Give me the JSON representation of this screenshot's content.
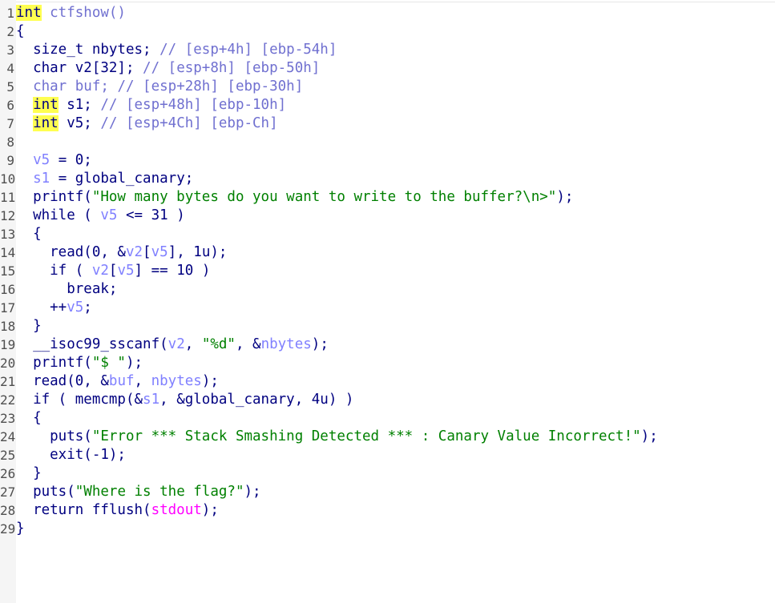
{
  "lines": [
    {
      "n": "1",
      "segs": [
        {
          "t": "int",
          "c": "kw hl"
        },
        {
          "t": " ctfshow()",
          "c": "bl"
        }
      ]
    },
    {
      "n": "2",
      "segs": [
        {
          "t": "{",
          "c": "plain"
        }
      ]
    },
    {
      "n": "3",
      "segs": [
        {
          "t": "  size_t nbytes; ",
          "c": "plain"
        },
        {
          "t": "// [esp+4h] [ebp-54h]",
          "c": "cmt"
        }
      ]
    },
    {
      "n": "4",
      "segs": [
        {
          "t": "  char v2[32]; ",
          "c": "plain"
        },
        {
          "t": "// [esp+8h] [ebp-50h]",
          "c": "cmt"
        }
      ]
    },
    {
      "n": "5",
      "segs": [
        {
          "t": "  char buf; ",
          "c": "bl"
        },
        {
          "t": "// [esp+28h] [ebp-30h]",
          "c": "cmt"
        }
      ]
    },
    {
      "n": "6",
      "segs": [
        {
          "t": "  ",
          "c": "plain"
        },
        {
          "t": "int",
          "c": "kw hl"
        },
        {
          "t": " s1; ",
          "c": "plain"
        },
        {
          "t": "// [esp+48h] [ebp-10h]",
          "c": "cmt"
        }
      ]
    },
    {
      "n": "7",
      "segs": [
        {
          "t": "  ",
          "c": "plain"
        },
        {
          "t": "int",
          "c": "kw hl"
        },
        {
          "t": " v5; ",
          "c": "plain"
        },
        {
          "t": "// [esp+4Ch] [ebp-Ch]",
          "c": "cmt"
        }
      ]
    },
    {
      "n": "8",
      "segs": []
    },
    {
      "n": "9",
      "segs": [
        {
          "t": "  ",
          "c": "plain"
        },
        {
          "t": "v5",
          "c": "var"
        },
        {
          "t": " = 0;",
          "c": "plain"
        }
      ]
    },
    {
      "n": "10",
      "segs": [
        {
          "t": "  ",
          "c": "plain"
        },
        {
          "t": "s1",
          "c": "var"
        },
        {
          "t": " = global_canary;",
          "c": "plain"
        }
      ]
    },
    {
      "n": "11",
      "segs": [
        {
          "t": "  printf(",
          "c": "plain"
        },
        {
          "t": "\"How many bytes do you want to write to the buffer?\\n>\"",
          "c": "str"
        },
        {
          "t": ");",
          "c": "plain"
        }
      ]
    },
    {
      "n": "12",
      "segs": [
        {
          "t": "  while ( ",
          "c": "plain"
        },
        {
          "t": "v5",
          "c": "var"
        },
        {
          "t": " <= 31 )",
          "c": "plain"
        }
      ]
    },
    {
      "n": "13",
      "segs": [
        {
          "t": "  {",
          "c": "plain"
        }
      ]
    },
    {
      "n": "14",
      "segs": [
        {
          "t": "    read(0, &",
          "c": "plain"
        },
        {
          "t": "v2",
          "c": "var"
        },
        {
          "t": "[",
          "c": "plain"
        },
        {
          "t": "v5",
          "c": "var"
        },
        {
          "t": "], 1u);",
          "c": "plain"
        }
      ]
    },
    {
      "n": "15",
      "segs": [
        {
          "t": "    if ( ",
          "c": "plain"
        },
        {
          "t": "v2",
          "c": "var"
        },
        {
          "t": "[",
          "c": "plain"
        },
        {
          "t": "v5",
          "c": "var"
        },
        {
          "t": "] == 10 )",
          "c": "plain"
        }
      ]
    },
    {
      "n": "16",
      "segs": [
        {
          "t": "      break;",
          "c": "plain"
        }
      ]
    },
    {
      "n": "17",
      "segs": [
        {
          "t": "    ++",
          "c": "plain"
        },
        {
          "t": "v5",
          "c": "var"
        },
        {
          "t": ";",
          "c": "plain"
        }
      ]
    },
    {
      "n": "18",
      "segs": [
        {
          "t": "  }",
          "c": "plain"
        }
      ]
    },
    {
      "n": "19",
      "segs": [
        {
          "t": "  __isoc99_sscanf(",
          "c": "plain"
        },
        {
          "t": "v2",
          "c": "var"
        },
        {
          "t": ", ",
          "c": "plain"
        },
        {
          "t": "\"%d\"",
          "c": "str"
        },
        {
          "t": ", &",
          "c": "plain"
        },
        {
          "t": "nbytes",
          "c": "var"
        },
        {
          "t": ");",
          "c": "plain"
        }
      ]
    },
    {
      "n": "20",
      "segs": [
        {
          "t": "  printf(",
          "c": "plain"
        },
        {
          "t": "\"$ \"",
          "c": "str"
        },
        {
          "t": ");",
          "c": "plain"
        }
      ]
    },
    {
      "n": "21",
      "segs": [
        {
          "t": "  read(0, &",
          "c": "plain"
        },
        {
          "t": "buf",
          "c": "var"
        },
        {
          "t": ", ",
          "c": "plain"
        },
        {
          "t": "nbytes",
          "c": "var"
        },
        {
          "t": ");",
          "c": "plain"
        }
      ]
    },
    {
      "n": "22",
      "segs": [
        {
          "t": "  if ( memcmp(&",
          "c": "plain"
        },
        {
          "t": "s1",
          "c": "var"
        },
        {
          "t": ", &global_canary, 4u) )",
          "c": "plain"
        }
      ]
    },
    {
      "n": "23",
      "segs": [
        {
          "t": "  {",
          "c": "plain"
        }
      ]
    },
    {
      "n": "24",
      "segs": [
        {
          "t": "    puts(",
          "c": "plain"
        },
        {
          "t": "\"Error *** Stack Smashing Detected *** : Canary Value Incorrect!\"",
          "c": "str"
        },
        {
          "t": ");",
          "c": "plain"
        }
      ]
    },
    {
      "n": "25",
      "segs": [
        {
          "t": "    exit(-1);",
          "c": "plain"
        }
      ]
    },
    {
      "n": "26",
      "segs": [
        {
          "t": "  }",
          "c": "plain"
        }
      ]
    },
    {
      "n": "27",
      "segs": [
        {
          "t": "  puts(",
          "c": "plain"
        },
        {
          "t": "\"Where is the flag?\"",
          "c": "str"
        },
        {
          "t": ");",
          "c": "plain"
        }
      ]
    },
    {
      "n": "28",
      "segs": [
        {
          "t": "  return fflush(",
          "c": "plain"
        },
        {
          "t": "stdout",
          "c": "glob"
        },
        {
          "t": ");",
          "c": "plain"
        }
      ]
    },
    {
      "n": "29",
      "segs": [
        {
          "t": "}",
          "c": "plain"
        }
      ]
    }
  ]
}
